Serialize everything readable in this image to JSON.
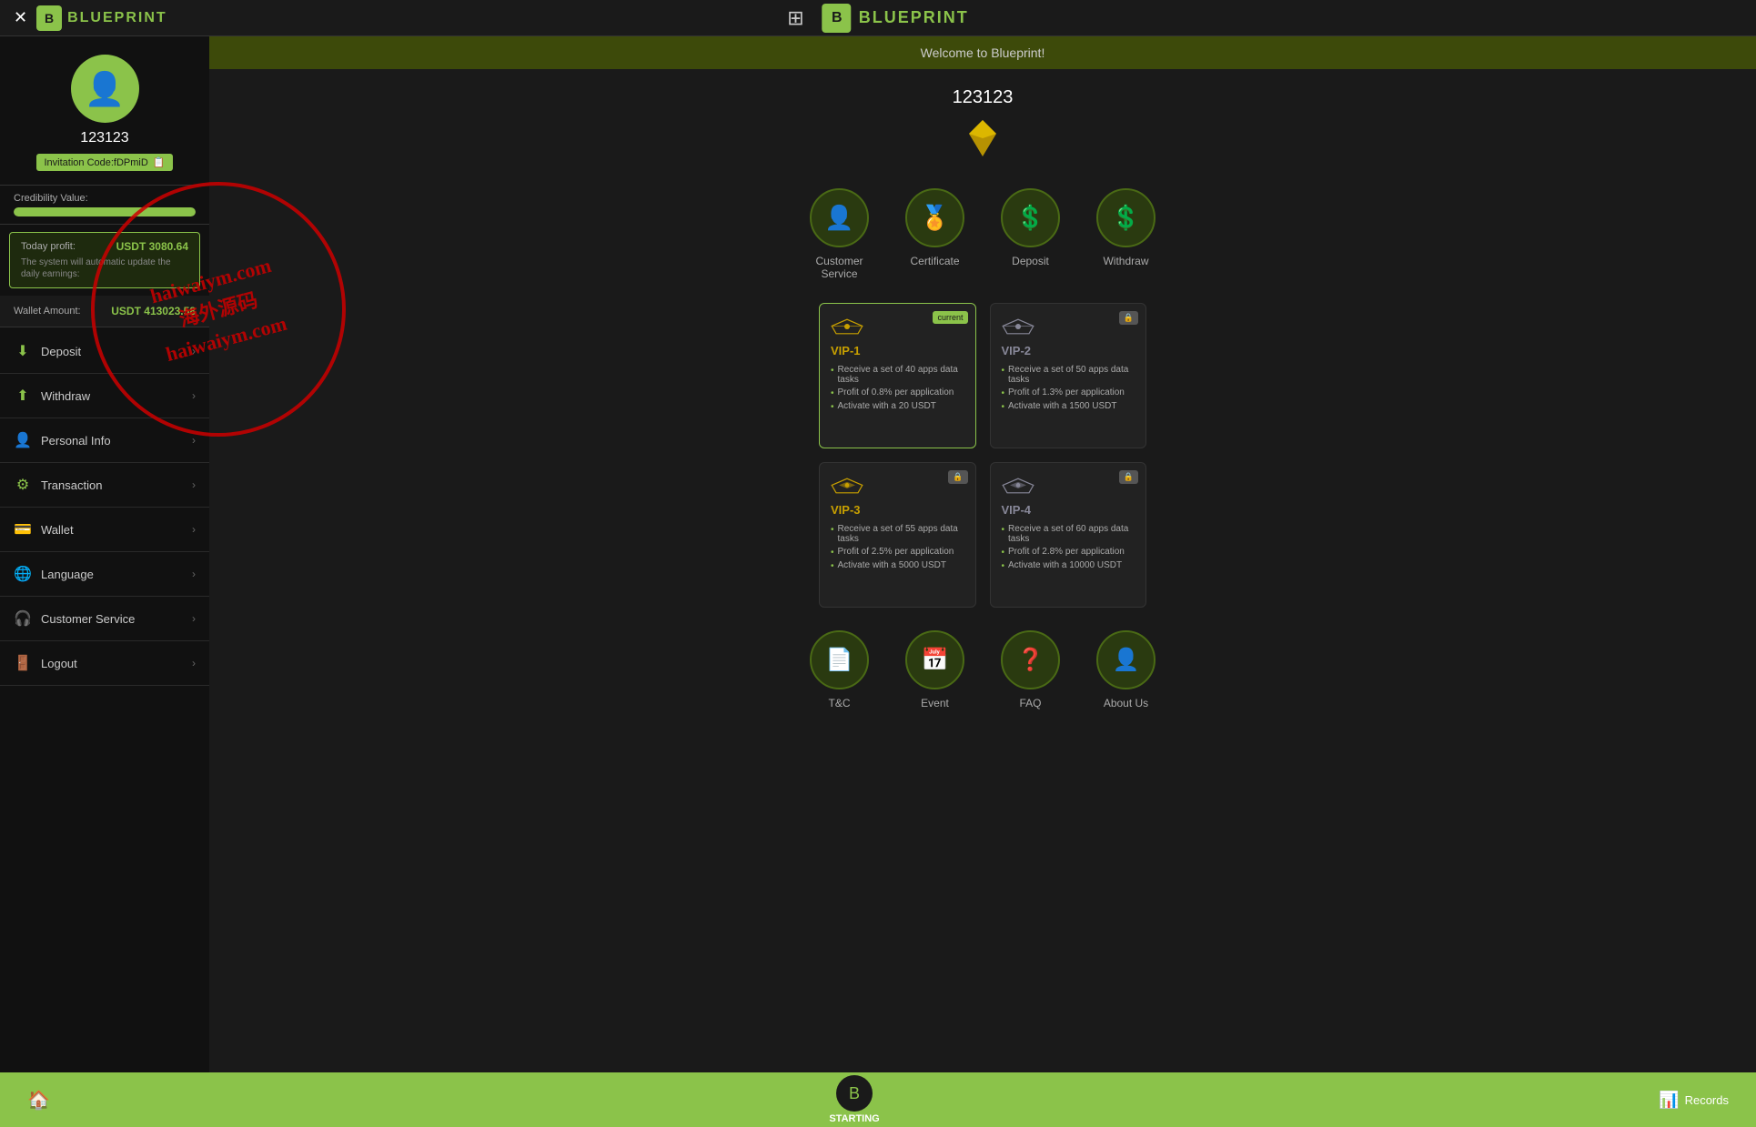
{
  "app": {
    "title": "Blueprint",
    "welcome_banner": "Welcome to Blueprint!"
  },
  "topbar": {
    "logo_text": "BLUEPRINT",
    "close_label": "✕",
    "grid_icon": "⊞"
  },
  "sidebar": {
    "username": "123123",
    "invitation_code": "Invitation Code:fDPmiD",
    "credibility_label": "Credibility Value:",
    "credibility_percent": 100,
    "today_profit_label": "Today profit:",
    "today_profit_value": "USDT 3080.64",
    "profit_note": "The system will automatic update the daily earnings:",
    "wallet_label": "Wallet Amount:",
    "wallet_value": "USDT 413023.58",
    "nav_items": [
      {
        "id": "deposit",
        "label": "Deposit",
        "icon": "⬇"
      },
      {
        "id": "withdraw",
        "label": "Withdraw",
        "icon": "⬆"
      },
      {
        "id": "personal-info",
        "label": "Personal Info",
        "icon": "👤"
      },
      {
        "id": "transaction",
        "label": "Transaction",
        "icon": "⚙"
      },
      {
        "id": "wallet",
        "label": "Wallet",
        "icon": "💳"
      },
      {
        "id": "language",
        "label": "Language",
        "icon": "🌐"
      },
      {
        "id": "customer-service",
        "label": "Customer Service",
        "icon": "🎧"
      },
      {
        "id": "logout",
        "label": "Logout",
        "icon": "🚪"
      }
    ]
  },
  "content": {
    "username": "123123",
    "quick_actions": [
      {
        "id": "customer-service",
        "label": "Customer\nService",
        "icon": "👤"
      },
      {
        "id": "certificate",
        "label": "Certificate",
        "icon": "🏅"
      },
      {
        "id": "deposit",
        "label": "Deposit",
        "icon": "💲"
      },
      {
        "id": "withdraw",
        "label": "Withdraw",
        "icon": "💲"
      }
    ],
    "vip_cards": [
      {
        "id": "vip1",
        "title": "VIP-1",
        "badge": "current",
        "badge_label": "current",
        "color": "gold",
        "features": [
          "Receive a set of 40 apps data tasks",
          "Profit of 0.8% per application",
          "Activate with a 20 USDT"
        ]
      },
      {
        "id": "vip2",
        "title": "VIP-2",
        "badge": "lock",
        "badge_label": "🔒",
        "color": "silver",
        "features": [
          "Receive a set of 50 apps data tasks",
          "Profit of 1.3% per application",
          "Activate with a 1500 USDT"
        ]
      },
      {
        "id": "vip3",
        "title": "VIP-3",
        "badge": "lock",
        "badge_label": "🔒",
        "color": "gold",
        "features": [
          "Receive a set of 55 apps data tasks",
          "Profit of 2.5% per application",
          "Activate with a 5000 USDT"
        ]
      },
      {
        "id": "vip4",
        "title": "VIP-4",
        "badge": "lock",
        "badge_label": "🔒",
        "color": "silver",
        "features": [
          "Receive a set of 60 apps data tasks",
          "Profit of 2.8% per application",
          "Activate with a 10000 USDT"
        ]
      }
    ],
    "bottom_icons": [
      {
        "id": "tandc",
        "label": "T&C",
        "icon": "📄"
      },
      {
        "id": "event",
        "label": "Event",
        "icon": "📅"
      },
      {
        "id": "faq",
        "label": "FAQ",
        "icon": "❓"
      },
      {
        "id": "about-us",
        "label": "About Us",
        "icon": "👤"
      }
    ]
  },
  "footer": {
    "home_icon": "🏠",
    "starting_label": "STARTING",
    "records_label": "Records",
    "records_icon": "📊"
  },
  "watermark": {
    "text": "haiwaiym.com\n海外源码\nhaiwaiym.com"
  }
}
